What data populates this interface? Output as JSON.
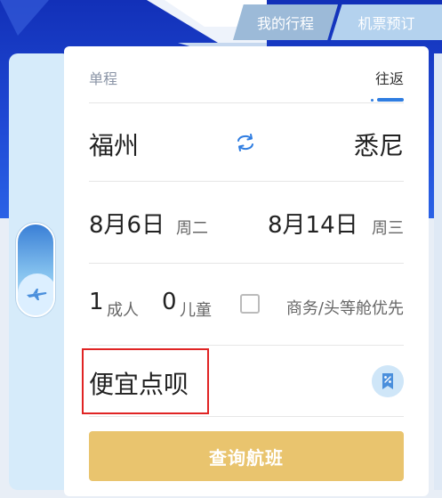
{
  "tabs": {
    "itinerary_label": "我的行程",
    "booking_label": "机票预订"
  },
  "trip_type": {
    "one_way": "单程",
    "round_trip": "往返"
  },
  "route": {
    "from_city": "福州",
    "to_city": "悉尼",
    "swap_icon": "swap-icon"
  },
  "dates": {
    "depart_date": "8月6日",
    "depart_day": "周二",
    "return_date": "8月14日",
    "return_day": "周三"
  },
  "passengers": {
    "adult_count": "1",
    "adult_label": "成人",
    "child_count": "0",
    "child_label": "儿童",
    "cabin_label": "商务/头等舱优先",
    "cabin_checked": false
  },
  "promo": {
    "text": "便宜点呗",
    "badge_icon": "discount-icon"
  },
  "search": {
    "label": "查询航班"
  },
  "colors": {
    "accent_blue": "#2f7de1",
    "header_blue": "#1f49d4",
    "button_gold": "#e9c46e",
    "highlight_red": "#e02424"
  }
}
